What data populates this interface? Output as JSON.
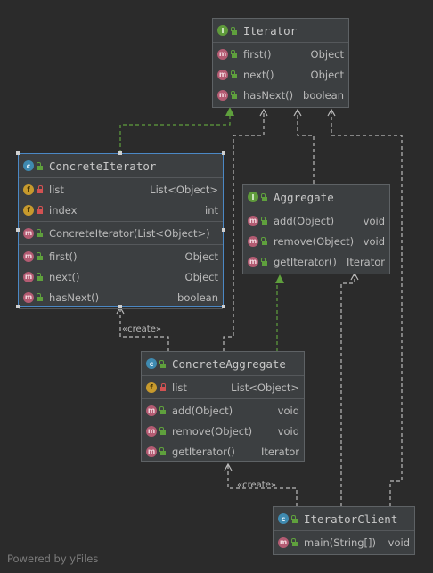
{
  "classes": {
    "iterator": {
      "name": "Iterator",
      "methods": [
        {
          "name": "first()",
          "type": "Object"
        },
        {
          "name": "next()",
          "type": "Object"
        },
        {
          "name": "hasNext()",
          "type": "boolean"
        }
      ]
    },
    "concrete_iterator": {
      "name": "ConcreteIterator",
      "fields": [
        {
          "name": "list",
          "type": "List<Object>"
        },
        {
          "name": "index",
          "type": "int"
        }
      ],
      "constructors": [
        {
          "name": "ConcreteIterator(List<Object>)",
          "type": ""
        }
      ],
      "methods": [
        {
          "name": "first()",
          "type": "Object"
        },
        {
          "name": "next()",
          "type": "Object"
        },
        {
          "name": "hasNext()",
          "type": "boolean"
        }
      ]
    },
    "aggregate": {
      "name": "Aggregate",
      "methods": [
        {
          "name": "add(Object)",
          "type": "void"
        },
        {
          "name": "remove(Object)",
          "type": "void"
        },
        {
          "name": "getIterator()",
          "type": "Iterator"
        }
      ]
    },
    "concrete_aggregate": {
      "name": "ConcreteAggregate",
      "fields": [
        {
          "name": "list",
          "type": "List<Object>"
        }
      ],
      "methods": [
        {
          "name": "add(Object)",
          "type": "void"
        },
        {
          "name": "remove(Object)",
          "type": "void"
        },
        {
          "name": "getIterator()",
          "type": "Iterator"
        }
      ]
    },
    "iterator_client": {
      "name": "IteratorClient",
      "methods": [
        {
          "name": "main(String[])",
          "type": "void"
        }
      ]
    }
  },
  "labels": {
    "create_1": "«create»",
    "create_2": "«create»"
  },
  "icons": {
    "m": "m",
    "f": "f",
    "c": "c",
    "i": "I"
  },
  "colors": {
    "background": "#2b2b2b",
    "node": "#3c3f41",
    "realization": "#5fa03d",
    "dependency": "#bbbbbb",
    "selection": "#4b88c5"
  },
  "footer": "Powered by yFiles"
}
